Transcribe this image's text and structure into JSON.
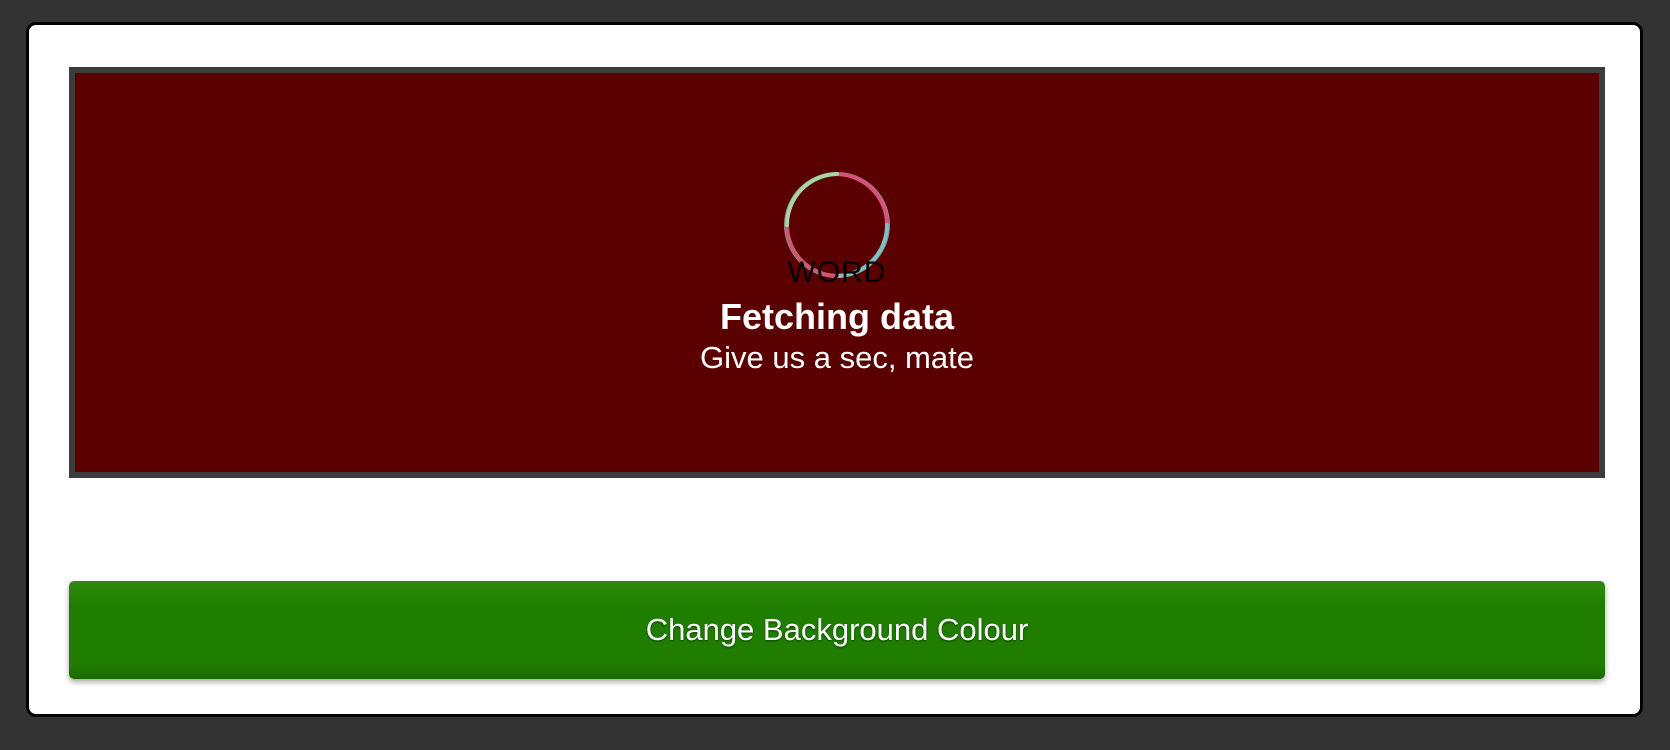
{
  "display": {
    "background_color": "#5a0000",
    "word": "WORD",
    "title": "Fetching data",
    "subtitle": "Give us a sec, mate",
    "spinner_colors": [
      "#e0507a",
      "#7fc4c0",
      "#a8d8a0"
    ]
  },
  "button": {
    "label": "Change Background Colour",
    "color": "#1f7e00"
  }
}
